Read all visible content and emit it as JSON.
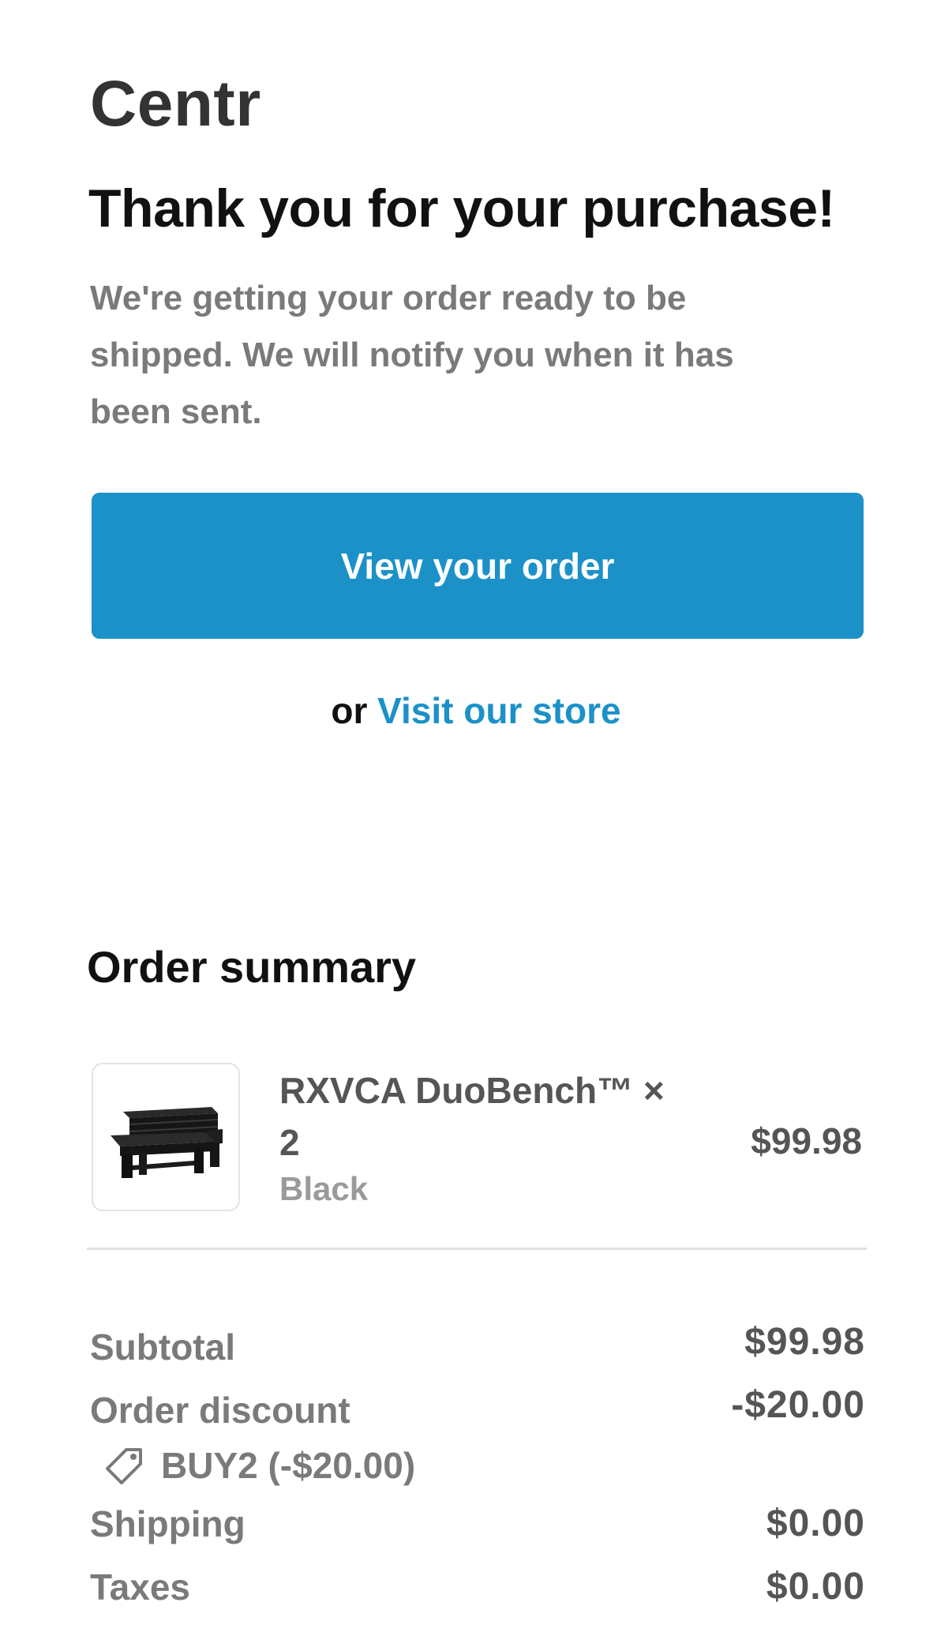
{
  "brand": {
    "name": "Centr"
  },
  "confirmation": {
    "title": "Thank you for your purchase!",
    "message": "We're getting your order ready to be shipped. We will notify you when it has been sent.",
    "view_order_label": "View your order",
    "or_text": "or",
    "visit_store_label": "Visit our store"
  },
  "summary": {
    "title": "Order summary",
    "item": {
      "name": "RXVCA DuoBench™ × 2",
      "variant": "Black",
      "price": "$99.98",
      "image_icon": "bench-image"
    },
    "subtotal_label": "Subtotal",
    "subtotal_value": "$99.98",
    "discount_label": "Order discount",
    "discount_value": "-$20.00",
    "discount_code": "BUY2 (-$20.00)",
    "discount_icon": "tag-icon",
    "shipping_label": "Shipping",
    "shipping_value": "$0.00",
    "taxes_label": "Taxes",
    "taxes_value": "$0.00"
  },
  "colors": {
    "accent": "#1b91c8",
    "brand_text": "#333333",
    "muted_text": "#7a7a7a"
  }
}
